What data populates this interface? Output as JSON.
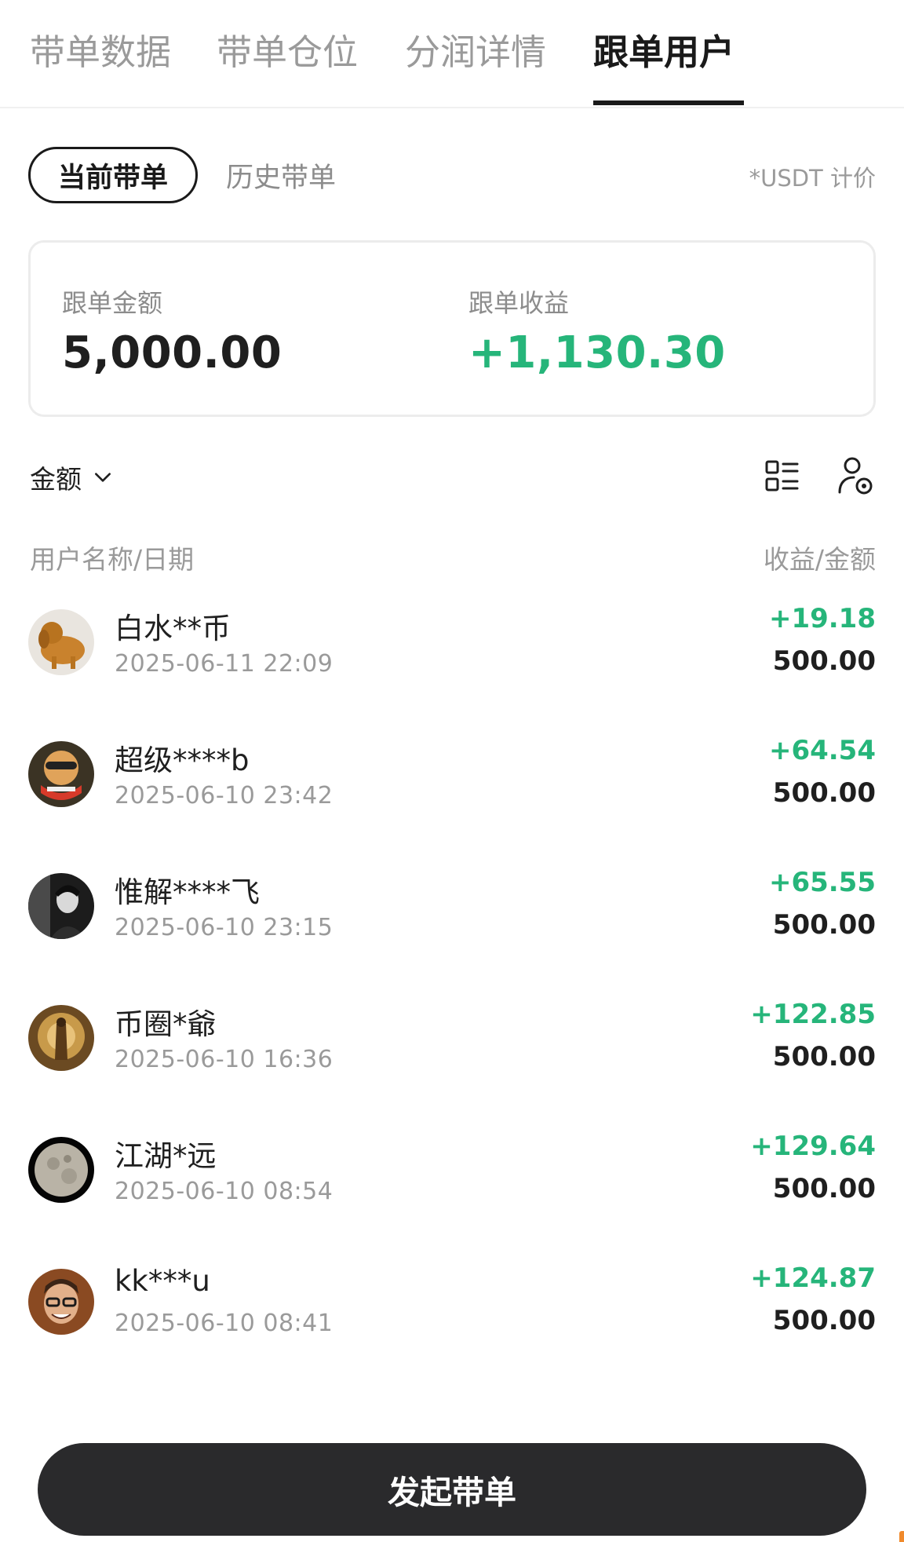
{
  "tabs": [
    "带单数据",
    "带单仓位",
    "分润详情",
    "跟单用户"
  ],
  "subtabs": {
    "current": "当前带单",
    "history": "历史带单"
  },
  "usdt_note": "*USDT 计价",
  "summary": {
    "amount_label": "跟单金额",
    "amount_value": "5,000.00",
    "profit_label": "跟单收益",
    "profit_value": "+1,130.30"
  },
  "sort": {
    "label": "金额"
  },
  "columns": {
    "left": "用户名称/日期",
    "right": "收益/金额"
  },
  "users": [
    {
      "name": "白水**币",
      "date": "2025-06-11 22:09",
      "profit": "+19.18",
      "amount": "500.00"
    },
    {
      "name": "超级****b",
      "date": "2025-06-10 23:42",
      "profit": "+64.54",
      "amount": "500.00"
    },
    {
      "name": "惟解****飞",
      "date": "2025-06-10 23:15",
      "profit": "+65.55",
      "amount": "500.00"
    },
    {
      "name": "币圈*爺",
      "date": "2025-06-10 16:36",
      "profit": "+122.85",
      "amount": "500.00"
    },
    {
      "name": "江湖*远",
      "date": "2025-06-10 08:54",
      "profit": "+129.64",
      "amount": "500.00"
    },
    {
      "name": "kk***u",
      "date": "2025-06-10 08:41",
      "profit": "+124.87",
      "amount": "500.00"
    }
  ],
  "cta_label": "发起带单",
  "colors": {
    "profit_green": "#26b57a",
    "button_dark": "#2a2a2c"
  },
  "icons": [
    "chevron-down-icon",
    "list-view-icon",
    "user-settings-icon"
  ]
}
